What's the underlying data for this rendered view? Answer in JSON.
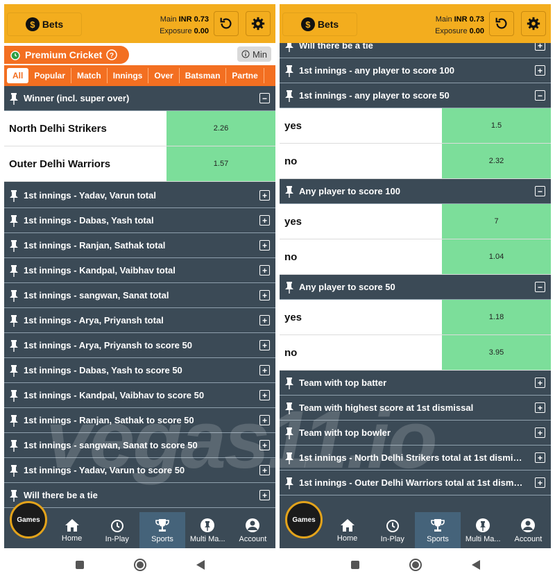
{
  "header": {
    "bets_label": "Bets",
    "main_label": "Main",
    "main_value": "INR 0.73",
    "exposure_label": "Exposure",
    "exposure_value": "0.00"
  },
  "left": {
    "section_title": "Premium Cricket",
    "min_label": "Min",
    "tabs": [
      "All",
      "Popular",
      "Match",
      "Innings",
      "Over",
      "Batsman",
      "Partne"
    ],
    "winner": {
      "title": "Winner (incl. super over)",
      "rows": [
        {
          "label": "North Delhi Strikers",
          "odds": "2.26"
        },
        {
          "label": "Outer Delhi Warriors",
          "odds": "1.57"
        }
      ]
    },
    "markets": [
      "1st innings - Yadav, Varun total",
      "1st innings - Dabas, Yash total",
      "1st innings - Ranjan, Sathak total",
      "1st innings - Kandpal, Vaibhav total",
      "1st innings - sangwan, Sanat total",
      "1st innings - Arya, Priyansh total",
      "1st innings - Arya, Priyansh to score 50",
      "1st innings - Dabas, Yash to score 50",
      "1st innings - Kandpal, Vaibhav to score 50",
      "1st innings - Ranjan, Sathak to score 50",
      "1st innings - sangwan, Sanat to score 50",
      "1st innings - Yadav, Varun to score 50",
      "Will there be a tie"
    ]
  },
  "right": {
    "top_markets": [
      "Will there be a tie",
      "1st innings - any player to score 100"
    ],
    "m1": {
      "title": "1st innings - any player to score 50",
      "rows": [
        {
          "label": "yes",
          "odds": "1.5"
        },
        {
          "label": "no",
          "odds": "2.32"
        }
      ]
    },
    "m2": {
      "title": "Any player to score 100",
      "rows": [
        {
          "label": "yes",
          "odds": "7"
        },
        {
          "label": "no",
          "odds": "1.04"
        }
      ]
    },
    "m3": {
      "title": "Any player to score 50",
      "rows": [
        {
          "label": "yes",
          "odds": "1.18"
        },
        {
          "label": "no",
          "odds": "3.95"
        }
      ]
    },
    "bottom_markets": [
      "Team with top batter",
      "Team with highest score at 1st dismissal",
      "Team with top bowler",
      "1st innings - North Delhi Strikers total at 1st dismis...",
      "1st innings - Outer Delhi Warriors total at 1st dismis..."
    ]
  },
  "nav": {
    "games": "Games",
    "items": [
      "Home",
      "In-Play",
      "Sports",
      "Multi Ma...",
      "Account"
    ]
  },
  "watermark": "vegas11.io"
}
